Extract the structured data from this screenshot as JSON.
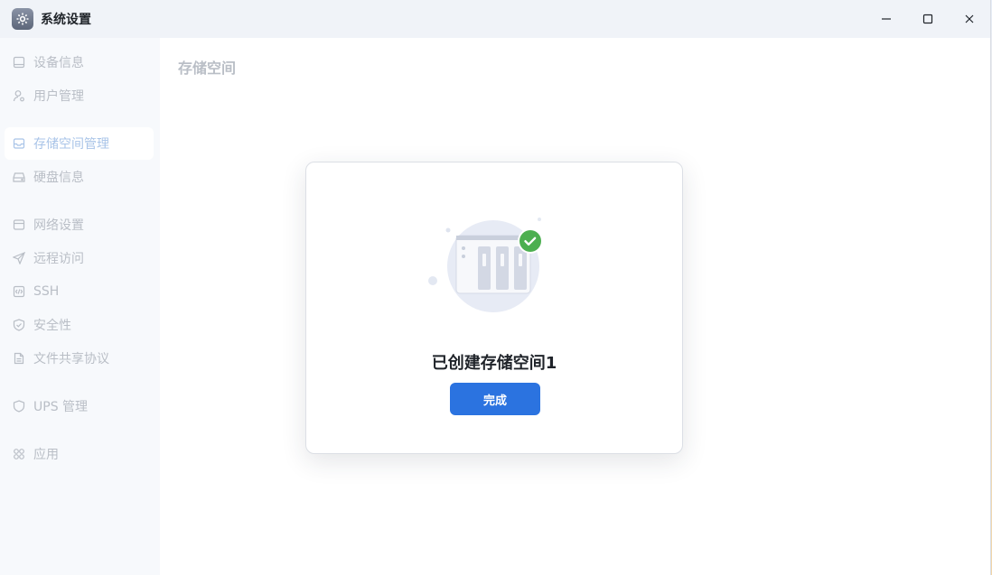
{
  "window": {
    "title": "系统设置",
    "icons": {
      "app": "gear-icon",
      "minimize": "minimize-icon",
      "maximize": "maximize-icon",
      "close": "close-icon"
    }
  },
  "sidebar": {
    "items": [
      {
        "label": "设备信息",
        "icon": "monitor-icon",
        "active": false
      },
      {
        "label": "用户管理",
        "icon": "user-icon",
        "active": false
      },
      {
        "label": "存储空间管理",
        "icon": "storage-icon",
        "active": true
      },
      {
        "label": "硬盘信息",
        "icon": "harddisk-icon",
        "active": false
      },
      {
        "label": "网络设置",
        "icon": "network-icon",
        "active": false
      },
      {
        "label": "远程访问",
        "icon": "send-icon",
        "active": false
      },
      {
        "label": "SSH",
        "icon": "code-icon",
        "active": false
      },
      {
        "label": "安全性",
        "icon": "shield-check-icon",
        "active": false
      },
      {
        "label": "文件共享协议",
        "icon": "document-icon",
        "active": false
      },
      {
        "label": "UPS 管理",
        "icon": "shield-icon",
        "active": false
      },
      {
        "label": "应用",
        "icon": "apps-icon",
        "active": false
      }
    ]
  },
  "main": {
    "page_title": "存储空间"
  },
  "dialog": {
    "message": "已创建存储空间1",
    "done_label": "完成",
    "illustration_icon": "nas-storage-icon",
    "status_icon": "check-circle-icon"
  },
  "colors": {
    "accent": "#2b73e0",
    "success": "#4caf50",
    "sidebar_text": "#b9bec6"
  }
}
